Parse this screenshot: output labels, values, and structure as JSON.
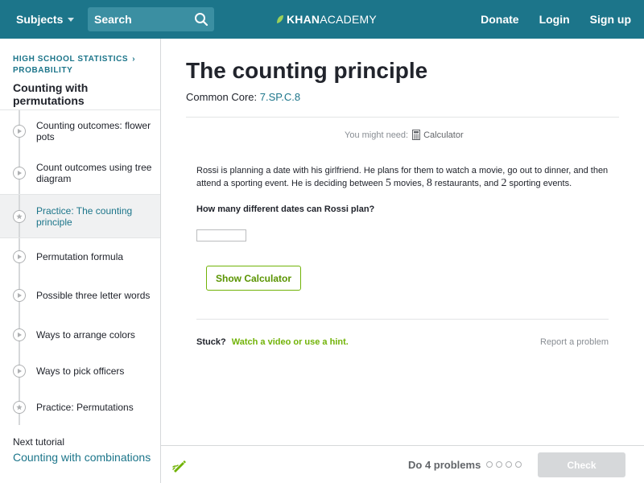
{
  "colors": {
    "header_bg": "#1c758a",
    "accent_green": "#71b307",
    "link_teal": "#1c758a",
    "check_disabled": "#d6d8da"
  },
  "header": {
    "subjects_label": "Subjects",
    "search_placeholder": "Search",
    "logo_khan": "KHAN",
    "logo_academy": "ACADEMY",
    "links": {
      "donate": "Donate",
      "login": "Login",
      "signup": "Sign up"
    }
  },
  "sidebar": {
    "breadcrumb_course": "HIGH SCHOOL STATISTICS",
    "breadcrumb_chevron": "›",
    "breadcrumb_unit": "PROBABILITY",
    "title": "Counting with permutations",
    "items": [
      {
        "label": "Counting outcomes: flower pots",
        "icon": "play-icon"
      },
      {
        "label": "Count outcomes using tree diagram",
        "icon": "play-icon"
      },
      {
        "label": "Practice: The counting principle",
        "icon": "star-icon"
      },
      {
        "label": "Permutation formula",
        "icon": "play-icon"
      },
      {
        "label": "Possible three letter words",
        "icon": "play-icon"
      },
      {
        "label": "Ways to arrange colors",
        "icon": "play-icon"
      },
      {
        "label": "Ways to pick officers",
        "icon": "play-icon"
      },
      {
        "label": "Practice: Permutations",
        "icon": "star-icon"
      }
    ],
    "next_label": "Next tutorial",
    "next_link": "Counting with combinations"
  },
  "main": {
    "title": "The counting principle",
    "common_core_label": "Common Core:",
    "common_core_code": "7.SP.C.8",
    "might_need_label": "You might need:",
    "calculator_label": "Calculator",
    "problem_part1": "Rossi is planning a date with his girlfriend. He plans for them to watch a movie, go out to dinner, and then attend a sporting event. He is deciding between ",
    "num_movies": "5",
    "problem_part2": " movies, ",
    "num_restaurants": "8",
    "problem_part3": " restaurants, and ",
    "num_events": "2",
    "problem_part4": " sporting events.",
    "question": "How many different dates can Rossi plan?",
    "answer_value": "",
    "show_calculator": "Show Calculator",
    "stuck_label": "Stuck?",
    "hint_link": "Watch a video or use a hint.",
    "report_link": "Report a problem"
  },
  "footer": {
    "do_problems": "Do 4 problems",
    "check": "Check"
  }
}
